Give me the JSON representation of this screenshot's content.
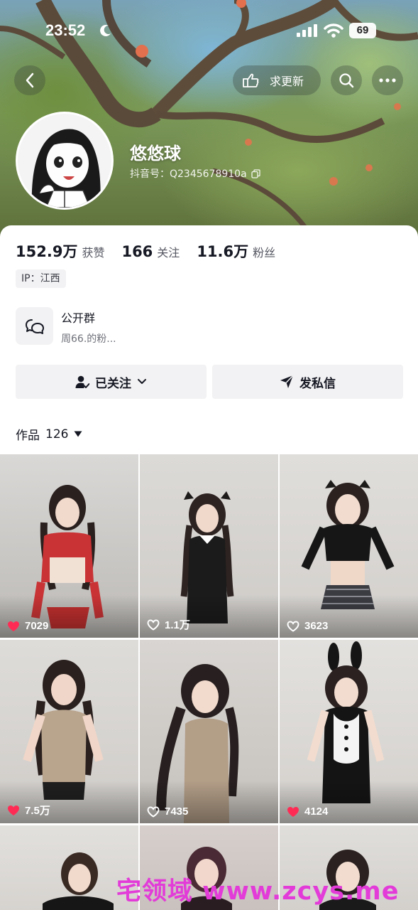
{
  "status_bar": {
    "time": "23:52",
    "battery": "69"
  },
  "header": {
    "request_update_label": "求更新"
  },
  "profile": {
    "nickname": "悠悠球",
    "douyin_id": "抖音号：Q2345678910a"
  },
  "stats": [
    {
      "value": "152.9万",
      "label": "获赞"
    },
    {
      "value": "166",
      "label": "关注"
    },
    {
      "value": "11.6万",
      "label": "粉丝"
    }
  ],
  "ip_location": "IP：江西",
  "group": {
    "title": "公开群",
    "subtitle": "周66.的粉..."
  },
  "actions": {
    "follow_label": "已关注",
    "message_label": "发私信"
  },
  "works": {
    "tab_label": "作品",
    "count": "126"
  },
  "videos": [
    {
      "likes": "7029",
      "liked": true
    },
    {
      "likes": "1.1万",
      "liked": false
    },
    {
      "likes": "3623",
      "liked": false
    },
    {
      "likes": "7.5万",
      "liked": true
    },
    {
      "likes": "7435",
      "liked": false
    },
    {
      "likes": "4124",
      "liked": true
    },
    {
      "likes": "",
      "liked": false
    },
    {
      "likes": "",
      "liked": false
    },
    {
      "likes": "",
      "liked": false
    }
  ],
  "watermark": "宅领域 www.zcys.me",
  "colors": {
    "liked_heart": "#fe2c55",
    "watermark": "#e23bd8"
  }
}
